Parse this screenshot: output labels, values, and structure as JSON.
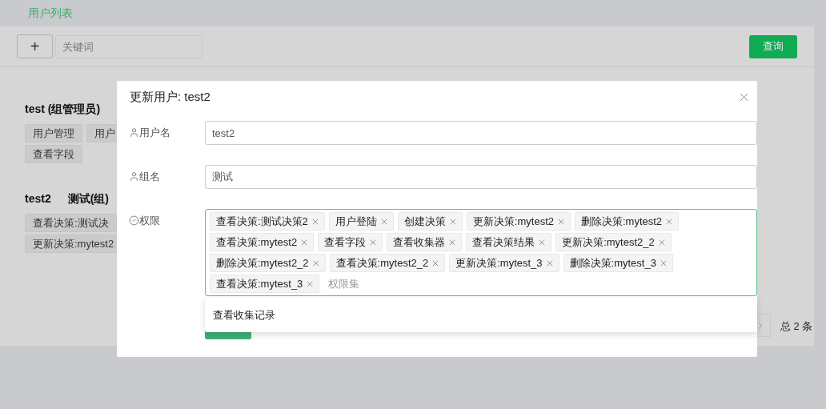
{
  "header": {
    "title": "用户列表"
  },
  "toolbar": {
    "add_button": "+",
    "search": {
      "placeholder": "关键词"
    },
    "query_button": "查询"
  },
  "users": [
    {
      "heading": [
        "test (组管理员)"
      ],
      "tag_rows": [
        [
          "用户管理",
          "用户"
        ],
        [
          "查看字段"
        ]
      ]
    },
    {
      "heading": [
        "test2",
        "测试(组)"
      ],
      "tag_rows": [
        [
          "查看决策:测试决"
        ],
        [
          "更新决策:mytest2"
        ]
      ]
    }
  ],
  "pagination": {
    "total": "总 2 条"
  },
  "dialog": {
    "title": "更新用户: test2",
    "fields": [
      {
        "kind": "text",
        "label": "用户名",
        "value": "test2"
      },
      {
        "kind": "text",
        "label": "组名",
        "value": "测试"
      },
      {
        "kind": "tags",
        "label": "权限",
        "focused": true,
        "placeholder": "权限集",
        "tags": [
          "查看决策:测试决策2",
          "用户登陆",
          "创建决策",
          "更新决策:mytest2",
          "删除决策:mytest2",
          "查看决策:mytest2",
          "查看字段",
          "查看收集器",
          "查看决策结果",
          "更新决策:mytest2_2",
          "删除决策:mytest2_2",
          "查看决策:mytest2_2",
          "更新决策:mytest_3",
          "删除决策:mytest_3",
          "查看决策:mytest_3"
        ]
      }
    ],
    "dropdown_options": [
      "查看收集记录"
    ]
  }
}
